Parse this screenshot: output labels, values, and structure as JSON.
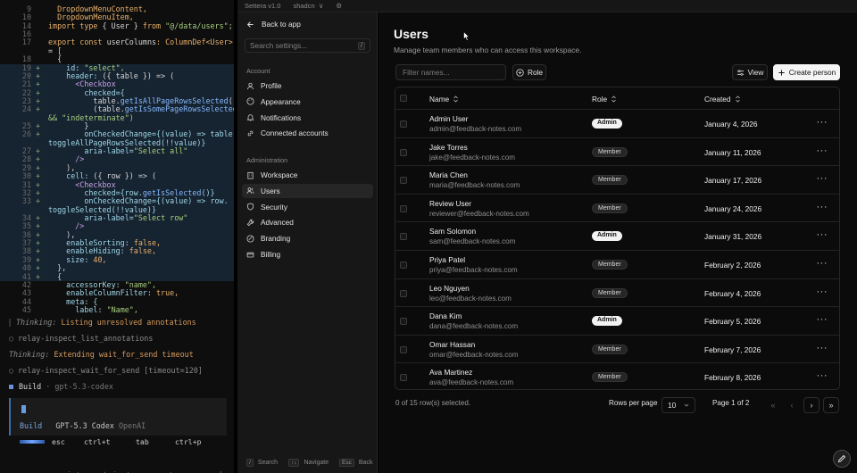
{
  "terminal": {
    "code_lines": [
      {
        "n": "9",
        "m": "",
        "add": false,
        "t": [
          [
            "  DropdownMenuContent,",
            "kw"
          ]
        ]
      },
      {
        "n": "10",
        "m": "",
        "add": false,
        "t": [
          [
            "  DropdownMenuItem,",
            "kw"
          ]
        ]
      },
      {
        "n": "14",
        "m": "",
        "add": false,
        "t": [
          [
            "import type ",
            "kw"
          ],
          [
            "{ User } ",
            "n"
          ],
          [
            "from ",
            "kw"
          ],
          [
            "\"@/data/users\";",
            "s"
          ]
        ]
      },
      {
        "n": "16",
        "m": "",
        "add": false,
        "t": [
          [
            "",
            ""
          ]
        ]
      },
      {
        "n": "17",
        "m": "",
        "add": false,
        "t": [
          [
            "export const ",
            "kw"
          ],
          [
            "userColumns",
            "n"
          ],
          [
            ": ColumnDef<User>[]",
            "kw"
          ]
        ]
      },
      {
        "n": "",
        "m": "",
        "add": false,
        "t": [
          [
            "= [",
            "n"
          ]
        ]
      },
      {
        "n": "18",
        "m": "",
        "add": false,
        "t": [
          [
            "  {",
            "n"
          ]
        ]
      },
      {
        "n": "19",
        "m": "+",
        "add": true,
        "t": [
          [
            "    id: ",
            "p"
          ],
          [
            "\"select\",",
            "s"
          ]
        ]
      },
      {
        "n": "20",
        "m": "+",
        "add": true,
        "t": [
          [
            "    header: ",
            "p"
          ],
          [
            "({ table }) => (",
            "n"
          ]
        ]
      },
      {
        "n": "21",
        "m": "+",
        "add": true,
        "t": [
          [
            "      <Checkbox",
            "c"
          ]
        ]
      },
      {
        "n": "22",
        "m": "+",
        "add": true,
        "t": [
          [
            "        checked={",
            "p"
          ]
        ]
      },
      {
        "n": "23",
        "m": "+",
        "add": true,
        "t": [
          [
            "          table.",
            "n"
          ],
          [
            "getIsAllPageRowsSelected",
            "f"
          ],
          [
            "() ||",
            "n"
          ]
        ]
      },
      {
        "n": "24",
        "m": "+",
        "add": true,
        "t": [
          [
            "          (table.",
            "n"
          ],
          [
            "getIsSomePageRowsSelected",
            "f"
          ],
          [
            "()",
            "n"
          ]
        ]
      },
      {
        "n": "",
        "m": "",
        "add": true,
        "t": [
          [
            "&& \"indeterminate\")",
            "s"
          ]
        ]
      },
      {
        "n": "25",
        "m": "+",
        "add": true,
        "t": [
          [
            "        }",
            "n"
          ]
        ]
      },
      {
        "n": "26",
        "m": "+",
        "add": true,
        "t": [
          [
            "        onCheckedChange={(value) => table.",
            "p"
          ]
        ]
      },
      {
        "n": "",
        "m": "",
        "add": true,
        "t": [
          [
            "toggleAllPageRowsSelected(!!value)}",
            "p"
          ]
        ]
      },
      {
        "n": "27",
        "m": "+",
        "add": true,
        "t": [
          [
            "        aria-label=",
            "p"
          ],
          [
            "\"Select all\"",
            "s"
          ]
        ]
      },
      {
        "n": "28",
        "m": "+",
        "add": true,
        "t": [
          [
            "      />",
            "c"
          ]
        ]
      },
      {
        "n": "29",
        "m": "+",
        "add": true,
        "t": [
          [
            "    ),",
            "n"
          ]
        ]
      },
      {
        "n": "30",
        "m": "+",
        "add": true,
        "t": [
          [
            "    cell: ",
            "p"
          ],
          [
            "({ row }) => (",
            "n"
          ]
        ]
      },
      {
        "n": "31",
        "m": "+",
        "add": true,
        "t": [
          [
            "      <Checkbox",
            "c"
          ]
        ]
      },
      {
        "n": "32",
        "m": "+",
        "add": true,
        "t": [
          [
            "        checked={row.",
            "p"
          ],
          [
            "getIsSelected",
            "f"
          ],
          [
            "()}",
            "p"
          ]
        ]
      },
      {
        "n": "33",
        "m": "+",
        "add": true,
        "t": [
          [
            "        onCheckedChange={(value) => row.",
            "p"
          ]
        ]
      },
      {
        "n": "",
        "m": "",
        "add": true,
        "t": [
          [
            "toggleSelected(!!value)}",
            "p"
          ]
        ]
      },
      {
        "n": "34",
        "m": "+",
        "add": true,
        "t": [
          [
            "        aria-label=",
            "p"
          ],
          [
            "\"Select row\"",
            "s"
          ]
        ]
      },
      {
        "n": "35",
        "m": "+",
        "add": true,
        "t": [
          [
            "      />",
            "c"
          ]
        ]
      },
      {
        "n": "36",
        "m": "+",
        "add": true,
        "t": [
          [
            "    ),",
            "n"
          ]
        ]
      },
      {
        "n": "37",
        "m": "+",
        "add": true,
        "t": [
          [
            "    enableSorting: ",
            "p"
          ],
          [
            "false,",
            "kw"
          ]
        ]
      },
      {
        "n": "38",
        "m": "+",
        "add": true,
        "t": [
          [
            "    enableHiding: ",
            "p"
          ],
          [
            "false,",
            "kw"
          ]
        ]
      },
      {
        "n": "39",
        "m": "+",
        "add": true,
        "t": [
          [
            "    size: ",
            "p"
          ],
          [
            "40,",
            "kw"
          ]
        ]
      },
      {
        "n": "40",
        "m": "+",
        "add": true,
        "t": [
          [
            "  },",
            "n"
          ]
        ]
      },
      {
        "n": "41",
        "m": "+",
        "add": true,
        "t": [
          [
            "  {",
            "n"
          ]
        ]
      },
      {
        "n": "42",
        "m": "",
        "add": false,
        "t": [
          [
            "    accessorKey: ",
            "p"
          ],
          [
            "\"name\",",
            "s"
          ]
        ]
      },
      {
        "n": "43",
        "m": "",
        "add": false,
        "t": [
          [
            "    enableColumnFilter: ",
            "p"
          ],
          [
            "true,",
            "kw"
          ]
        ]
      },
      {
        "n": "44",
        "m": "",
        "add": false,
        "t": [
          [
            "    meta: {",
            "p"
          ]
        ]
      },
      {
        "n": "45",
        "m": "",
        "add": false,
        "t": [
          [
            "      label: ",
            "p"
          ],
          [
            "\"Name\",",
            "s"
          ]
        ]
      }
    ],
    "thinking1_label": "Thinking:",
    "thinking1_text": "Listing unresolved annotations",
    "tool1": "relay-inspect_list_annotations",
    "thinking2_label": "Thinking:",
    "thinking2_text": "Extending wait_for_send timeout",
    "tool2": "relay-inspect_wait_for_send [timeout=120]",
    "build_label": "Build",
    "build_model": "· gpt-5.3-codex",
    "input_mode": "Build",
    "input_model": "GPT-5.3 Codex",
    "input_provider": "OpenAI",
    "keys": [
      {
        "key": "esc",
        "desc": "interrupt"
      },
      {
        "key": "ctrl+t",
        "desc": "variants"
      },
      {
        "key": "tab",
        "desc": "agents"
      },
      {
        "key": "ctrl+p",
        "desc": "commands"
      }
    ]
  },
  "topbar": {
    "app": "Settera v1.0",
    "theme": "shadcn",
    "chevron": "∨",
    "settings": "⚙"
  },
  "sidebar": {
    "back_label": "Back to app",
    "search_placeholder": "Search settings...",
    "search_kbd": "/",
    "account_header": "Account",
    "account_items": [
      {
        "label": "Profile",
        "icon": "user-icon"
      },
      {
        "label": "Appearance",
        "icon": "palette-icon"
      },
      {
        "label": "Notifications",
        "icon": "bell-icon"
      },
      {
        "label": "Connected accounts",
        "icon": "link-icon"
      }
    ],
    "admin_header": "Administration",
    "admin_items": [
      {
        "label": "Workspace",
        "icon": "building-icon"
      },
      {
        "label": "Users",
        "icon": "users-icon"
      },
      {
        "label": "Security",
        "icon": "shield-icon"
      },
      {
        "label": "Advanced",
        "icon": "wrench-icon"
      },
      {
        "label": "Branding",
        "icon": "brush-icon"
      },
      {
        "label": "Billing",
        "icon": "card-icon"
      }
    ],
    "active": "Users",
    "footer": {
      "search_kbd": "/",
      "search_label": "Search",
      "nav_kbd": "↑↓",
      "nav_label": "Navigate",
      "back_kbd": "Esc",
      "back_label": "Back"
    }
  },
  "main": {
    "title": "Users",
    "subtitle": "Manage team members who can access this workspace.",
    "filter_placeholder": "Filter names...",
    "role_button": "Role",
    "view_button": "View",
    "create_button": "Create person",
    "columns": {
      "name": "Name",
      "role": "Role",
      "created": "Created"
    },
    "rows": [
      {
        "name": "Admin User",
        "email": "admin@feedback-notes.com",
        "role": "Admin",
        "created": "January 4, 2026"
      },
      {
        "name": "Jake Torres",
        "email": "jake@feedback-notes.com",
        "role": "Member",
        "created": "January 11, 2026"
      },
      {
        "name": "Maria Chen",
        "email": "maria@feedback-notes.com",
        "role": "Member",
        "created": "January 17, 2026"
      },
      {
        "name": "Review User",
        "email": "reviewer@feedback-notes.com",
        "role": "Member",
        "created": "January 24, 2026"
      },
      {
        "name": "Sam Solomon",
        "email": "sam@feedback-notes.com",
        "role": "Admin",
        "created": "January 31, 2026"
      },
      {
        "name": "Priya Patel",
        "email": "priya@feedback-notes.com",
        "role": "Member",
        "created": "February 2, 2026"
      },
      {
        "name": "Leo Nguyen",
        "email": "leo@feedback-notes.com",
        "role": "Member",
        "created": "February 4, 2026"
      },
      {
        "name": "Dana Kim",
        "email": "dana@feedback-notes.com",
        "role": "Admin",
        "created": "February 5, 2026"
      },
      {
        "name": "Omar Hassan",
        "email": "omar@feedback-notes.com",
        "role": "Member",
        "created": "February 7, 2026"
      },
      {
        "name": "Ava Martinez",
        "email": "ava@feedback-notes.com",
        "role": "Member",
        "created": "February 8, 2026"
      }
    ],
    "row_actions": "···",
    "selection_status": "0 of 15 row(s) selected.",
    "rows_per_page_label": "Rows per page",
    "rows_per_page_value": "10",
    "page_status": "Page 1 of 2",
    "pager": {
      "first": "«",
      "prev": "‹",
      "next": "›",
      "last": "»"
    }
  },
  "colors": {
    "accent": "#f5f5f5",
    "admin_badge": "#f2f2f2",
    "member_badge": "#262626",
    "diff_add": "#162330"
  }
}
